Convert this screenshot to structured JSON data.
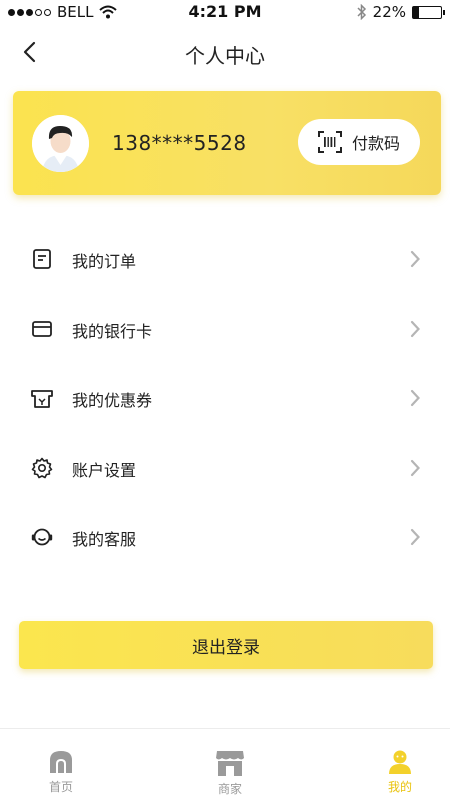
{
  "status_bar": {
    "carrier": "BELL",
    "time": "4:21 PM",
    "battery_percent": "22%",
    "battery_level": 0.22,
    "icons": [
      "signal-dots-icon",
      "wifi-icon",
      "bluetooth-icon",
      "battery-icon"
    ]
  },
  "navbar": {
    "title": "个人中心",
    "back_icon": "chevron-left-icon"
  },
  "profile": {
    "phone": "138****5528",
    "avatar_icon": "user-avatar",
    "pay_button_label": "付款码",
    "pay_button_icon": "barcode-scan-icon"
  },
  "menu": {
    "items": [
      {
        "label": "我的订单",
        "icon": "order-document-icon"
      },
      {
        "label": "我的银行卡",
        "icon": "bank-card-icon"
      },
      {
        "label": "我的优惠券",
        "icon": "coupon-icon"
      },
      {
        "label": "账户设置",
        "icon": "gear-icon"
      },
      {
        "label": "我的客服",
        "icon": "customer-service-icon"
      }
    ],
    "arrow_icon": "chevron-right-icon"
  },
  "logout": {
    "label": "退出登录"
  },
  "tabbar": {
    "tabs": [
      {
        "label": "首页",
        "icon": "home-icon",
        "active": false
      },
      {
        "label": "商家",
        "icon": "store-icon",
        "active": false
      },
      {
        "label": "我的",
        "icon": "user-icon",
        "active": true
      }
    ]
  },
  "colors": {
    "accent": "#f8e065",
    "active_tab": "#e9c30e",
    "inactive_tab": "#9a9a9a"
  }
}
